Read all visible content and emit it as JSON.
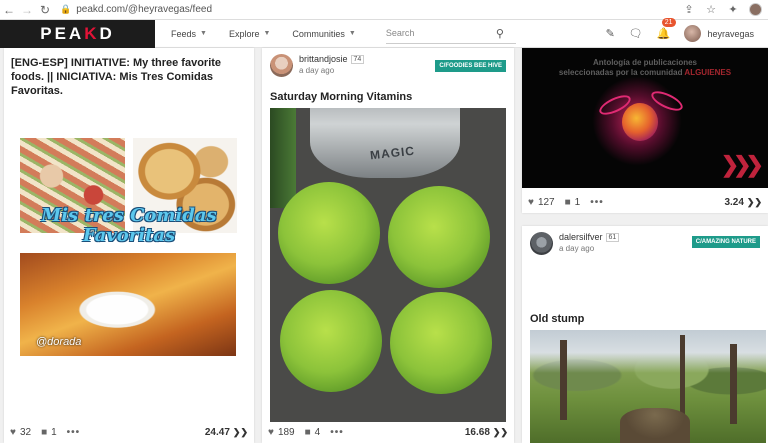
{
  "browser": {
    "url": "peakd.com/@heyravegas/feed"
  },
  "header": {
    "logo_left": "PEA",
    "logo_k": "K",
    "logo_right": "D",
    "menu": [
      {
        "label": "Feeds"
      },
      {
        "label": "Explore"
      },
      {
        "label": "Communities"
      }
    ],
    "search_placeholder": "Search",
    "notifications_count": "21",
    "username": "heyravegas"
  },
  "posts": [
    {
      "title": "[ENG-ESP] INITIATIVE: My three favorite foods. || INICIATIVA: Mis Tres Comidas Favoritas.",
      "image_caption": "Mis tres Comidas Favoritas",
      "image_signature": "@dorada",
      "votes": "32",
      "comments": "1",
      "payout": "24.47"
    },
    {
      "author": "brittandjosie",
      "reputation": "74",
      "time": "a day ago",
      "community": "C/FOODIES BEE HIVE",
      "title": "Saturday Morning Vitamins",
      "image_label": "MAGIC",
      "votes": "189",
      "comments": "4",
      "payout": "16.68"
    },
    {
      "image_text_line1": "Antología de publicaciones",
      "image_text_line2": "seleccionadas por la comunidad",
      "image_text_red": "ALGUIENES",
      "votes": "127",
      "comments": "1",
      "payout": "3.24"
    },
    {
      "author": "dalersilfver",
      "reputation": "61",
      "time": "a day ago",
      "community": "C/AMAZING NATURE",
      "title": "Old stump"
    }
  ],
  "colors": {
    "brand_red": "#e31337",
    "community_teal": "#1e9b8a",
    "badge_orange": "#e8552e",
    "logo_bg": "#1c1c1c"
  }
}
